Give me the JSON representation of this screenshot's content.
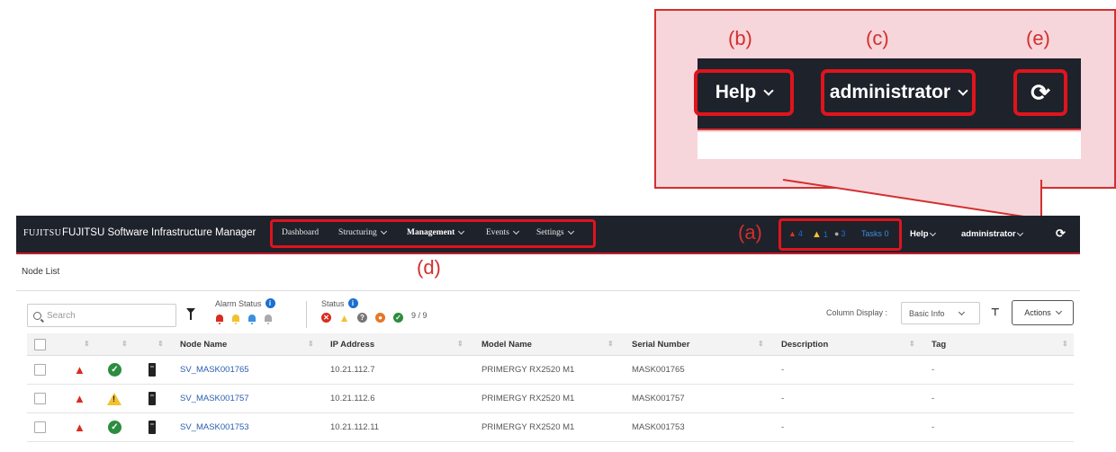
{
  "callout": {
    "labels": {
      "b": "(b)",
      "c": "(c)",
      "e": "(e)",
      "a": "(a)",
      "d": "(d)"
    },
    "help": "Help",
    "admin": "administrator",
    "refresh": "⟳"
  },
  "header": {
    "logo": "FUJITSU",
    "title": "FUJITSU Software Infrastructure Manager",
    "nav": [
      "Dashboard",
      "Structuring",
      "Management",
      "Events",
      "Settings"
    ],
    "status": {
      "alarm_red": "4",
      "alarm_warn": "1",
      "info": "3",
      "tasks": "Tasks 0"
    },
    "help": "Help",
    "user": "administrator",
    "refresh": "⟳"
  },
  "breadcrumb": "Node List",
  "toolbar": {
    "search_placeholder": "Search",
    "alarm_status_label": "Alarm Status",
    "status_label": "Status",
    "status_count": "9 / 9",
    "column_display_label": "Column Display :",
    "column_display_value": "Basic Info",
    "actions": "Actions"
  },
  "colors": {
    "accent_red": "#e0141d",
    "topbar": "#1e222b",
    "link": "#2a5db0"
  },
  "table": {
    "headers": [
      "Node Name",
      "IP Address",
      "Model Name",
      "Serial Number",
      "Description",
      "Tag"
    ],
    "rows": [
      {
        "status": "ok",
        "node": "SV_MASK001765",
        "ip": "10.21.112.7",
        "model": "PRIMERGY RX2520 M1",
        "serial": "MASK001765",
        "desc": "-",
        "tag": "-"
      },
      {
        "status": "warning",
        "node": "SV_MASK001757",
        "ip": "10.21.112.6",
        "model": "PRIMERGY RX2520 M1",
        "serial": "MASK001757",
        "desc": "-",
        "tag": "-"
      },
      {
        "status": "ok",
        "node": "SV_MASK001753",
        "ip": "10.21.112.11",
        "model": "PRIMERGY RX2520 M1",
        "serial": "MASK001753",
        "desc": "-",
        "tag": "-"
      }
    ]
  }
}
